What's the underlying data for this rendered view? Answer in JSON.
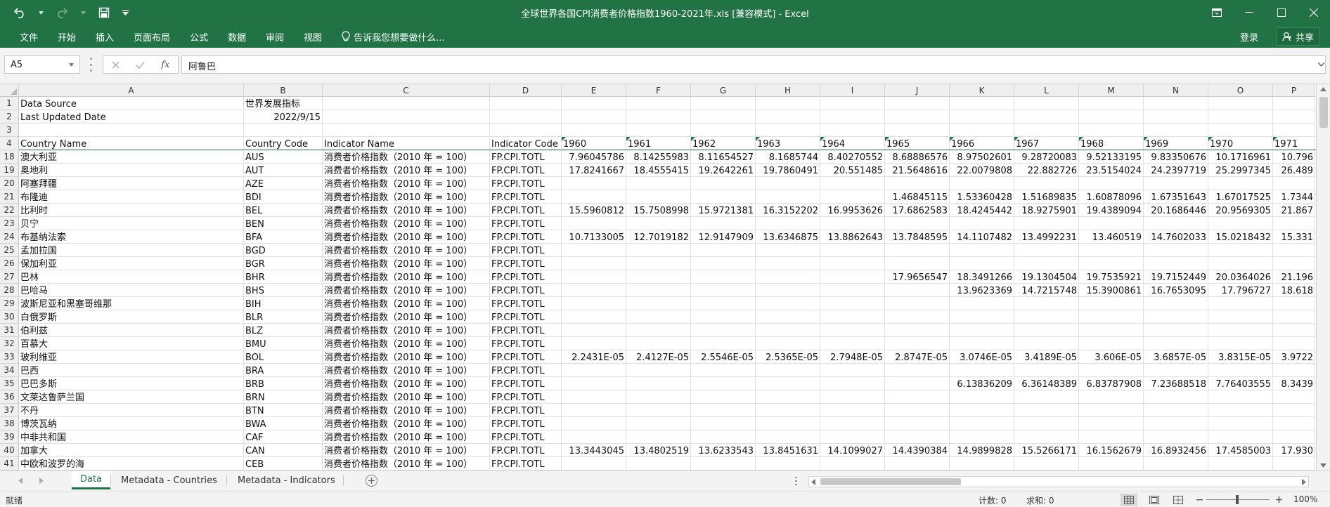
{
  "window": {
    "title": "全球世界各国CPI消费者价格指数1960-2021年.xls  [兼容模式] - Excel"
  },
  "ribbon": {
    "tabs": [
      "文件",
      "开始",
      "插入",
      "页面布局",
      "公式",
      "数据",
      "审阅",
      "视图"
    ],
    "tell_me": "告诉我您想要做什么...",
    "signin": "登录",
    "share": "共享"
  },
  "formula_bar": {
    "name_box": "A5",
    "fx": "fx",
    "content": "阿鲁巴"
  },
  "grid": {
    "column_headers": [
      "A",
      "B",
      "C",
      "D",
      "E",
      "F",
      "G",
      "H",
      "I",
      "J",
      "K",
      "L",
      "M",
      "N",
      "O",
      "P"
    ],
    "row_numbers": [
      "1",
      "2",
      "3",
      "4",
      "18",
      "19",
      "20",
      "21",
      "22",
      "23",
      "24",
      "25",
      "26",
      "27",
      "28",
      "29",
      "30",
      "31",
      "32",
      "33",
      "34",
      "35",
      "36",
      "37",
      "38",
      "39",
      "40",
      "41"
    ],
    "header_rows": [
      [
        "Data Source",
        "世界发展指标",
        "",
        "",
        "",
        "",
        "",
        "",
        "",
        "",
        "",
        "",
        "",
        "",
        "",
        ""
      ],
      [
        "Last Updated Date",
        "2022/9/15",
        "",
        "",
        "",
        "",
        "",
        "",
        "",
        "",
        "",
        "",
        "",
        "",
        "",
        ""
      ],
      [
        "",
        "",
        "",
        "",
        "",
        "",
        "",
        "",
        "",
        "",
        "",
        "",
        "",
        "",
        "",
        ""
      ],
      [
        "Country Name",
        "Country Code",
        "Indicator Name",
        "Indicator Code",
        "1960",
        "1961",
        "1962",
        "1963",
        "1964",
        "1965",
        "1966",
        "1967",
        "1968",
        "1969",
        "1970",
        "1971"
      ]
    ],
    "rows": [
      [
        "澳大利亚",
        "AUS",
        "消费者价格指数（2010 年 = 100）",
        "FP.CPI.TOTL",
        "7.96045786",
        "8.14255983",
        "8.11654527",
        "8.1685744",
        "8.40270552",
        "8.68886576",
        "8.97502601",
        "9.28720083",
        "9.52133195",
        "9.83350676",
        "10.1716961",
        "10.796"
      ],
      [
        "奥地利",
        "AUT",
        "消费者价格指数（2010 年 = 100）",
        "FP.CPI.TOTL",
        "17.8241667",
        "18.4555415",
        "19.2642261",
        "19.7860491",
        "20.551485",
        "21.5648616",
        "22.0079808",
        "22.882726",
        "23.5154024",
        "24.2397719",
        "25.2997345",
        "26.489"
      ],
      [
        "阿塞拜疆",
        "AZE",
        "消费者价格指数（2010 年 = 100）",
        "FP.CPI.TOTL",
        "",
        "",
        "",
        "",
        "",
        "",
        "",
        "",
        "",
        "",
        "",
        ""
      ],
      [
        "布隆迪",
        "BDI",
        "消费者价格指数（2010 年 = 100）",
        "FP.CPI.TOTL",
        "",
        "",
        "",
        "",
        "",
        "1.46845115",
        "1.53360428",
        "1.51689835",
        "1.60878096",
        "1.67351643",
        "1.67017525",
        "1.7344"
      ],
      [
        "比利时",
        "BEL",
        "消费者价格指数（2010 年 = 100）",
        "FP.CPI.TOTL",
        "15.5960812",
        "15.7508998",
        "15.9721381",
        "16.3152202",
        "16.9953626",
        "17.6862583",
        "18.4245442",
        "18.9275901",
        "19.4389094",
        "20.1686446",
        "20.9569305",
        "21.867"
      ],
      [
        "贝宁",
        "BEN",
        "消费者价格指数（2010 年 = 100）",
        "FP.CPI.TOTL",
        "",
        "",
        "",
        "",
        "",
        "",
        "",
        "",
        "",
        "",
        "",
        ""
      ],
      [
        "布基纳法索",
        "BFA",
        "消费者价格指数（2010 年 = 100）",
        "FP.CPI.TOTL",
        "10.7133005",
        "12.7019182",
        "12.9147909",
        "13.6346875",
        "13.8862643",
        "13.7848595",
        "14.1107482",
        "13.4992231",
        "13.460519",
        "14.7602033",
        "15.0218432",
        "15.331"
      ],
      [
        "孟加拉国",
        "BGD",
        "消费者价格指数（2010 年 = 100）",
        "FP.CPI.TOTL",
        "",
        "",
        "",
        "",
        "",
        "",
        "",
        "",
        "",
        "",
        "",
        ""
      ],
      [
        "保加利亚",
        "BGR",
        "消费者价格指数（2010 年 = 100）",
        "FP.CPI.TOTL",
        "",
        "",
        "",
        "",
        "",
        "",
        "",
        "",
        "",
        "",
        "",
        ""
      ],
      [
        "巴林",
        "BHR",
        "消费者价格指数（2010 年 = 100）",
        "FP.CPI.TOTL",
        "",
        "",
        "",
        "",
        "",
        "17.9656547",
        "18.3491266",
        "19.1304504",
        "19.7535921",
        "19.7152449",
        "20.0364026",
        "21.196"
      ],
      [
        "巴哈马",
        "BHS",
        "消费者价格指数（2010 年 = 100）",
        "FP.CPI.TOTL",
        "",
        "",
        "",
        "",
        "",
        "",
        "13.9623369",
        "14.7215748",
        "15.3900861",
        "16.7653095",
        "17.796727",
        "18.618"
      ],
      [
        "波斯尼亚和黑塞哥维那",
        "BIH",
        "消费者价格指数（2010 年 = 100）",
        "FP.CPI.TOTL",
        "",
        "",
        "",
        "",
        "",
        "",
        "",
        "",
        "",
        "",
        "",
        ""
      ],
      [
        "白俄罗斯",
        "BLR",
        "消费者价格指数（2010 年 = 100）",
        "FP.CPI.TOTL",
        "",
        "",
        "",
        "",
        "",
        "",
        "",
        "",
        "",
        "",
        "",
        ""
      ],
      [
        "伯利兹",
        "BLZ",
        "消费者价格指数（2010 年 = 100）",
        "FP.CPI.TOTL",
        "",
        "",
        "",
        "",
        "",
        "",
        "",
        "",
        "",
        "",
        "",
        ""
      ],
      [
        "百慕大",
        "BMU",
        "消费者价格指数（2010 年 = 100）",
        "FP.CPI.TOTL",
        "",
        "",
        "",
        "",
        "",
        "",
        "",
        "",
        "",
        "",
        "",
        ""
      ],
      [
        "玻利维亚",
        "BOL",
        "消费者价格指数（2010 年 = 100）",
        "FP.CPI.TOTL",
        "2.2431E-05",
        "2.4127E-05",
        "2.5546E-05",
        "2.5365E-05",
        "2.7948E-05",
        "2.8747E-05",
        "3.0746E-05",
        "3.4189E-05",
        "3.606E-05",
        "3.6857E-05",
        "3.8315E-05",
        "3.9722"
      ],
      [
        "巴西",
        "BRA",
        "消费者价格指数（2010 年 = 100）",
        "FP.CPI.TOTL",
        "",
        "",
        "",
        "",
        "",
        "",
        "",
        "",
        "",
        "",
        "",
        ""
      ],
      [
        "巴巴多斯",
        "BRB",
        "消费者价格指数（2010 年 = 100）",
        "FP.CPI.TOTL",
        "",
        "",
        "",
        "",
        "",
        "",
        "6.13836209",
        "6.36148389",
        "6.83787908",
        "7.23688518",
        "7.76403555",
        "8.3439"
      ],
      [
        "文莱达鲁萨兰国",
        "BRN",
        "消费者价格指数（2010 年 = 100）",
        "FP.CPI.TOTL",
        "",
        "",
        "",
        "",
        "",
        "",
        "",
        "",
        "",
        "",
        "",
        ""
      ],
      [
        "不丹",
        "BTN",
        "消费者价格指数（2010 年 = 100）",
        "FP.CPI.TOTL",
        "",
        "",
        "",
        "",
        "",
        "",
        "",
        "",
        "",
        "",
        "",
        ""
      ],
      [
        "博茨瓦纳",
        "BWA",
        "消费者价格指数（2010 年 = 100）",
        "FP.CPI.TOTL",
        "",
        "",
        "",
        "",
        "",
        "",
        "",
        "",
        "",
        "",
        "",
        ""
      ],
      [
        "中非共和国",
        "CAF",
        "消费者价格指数（2010 年 = 100）",
        "FP.CPI.TOTL",
        "",
        "",
        "",
        "",
        "",
        "",
        "",
        "",
        "",
        "",
        "",
        ""
      ],
      [
        "加拿大",
        "CAN",
        "消费者价格指数（2010 年 = 100）",
        "FP.CPI.TOTL",
        "13.3443045",
        "13.4802519",
        "13.6233543",
        "13.8451631",
        "14.1099027",
        "14.4390384",
        "14.9899828",
        "15.5266171",
        "16.1562679",
        "16.8932456",
        "17.4585003",
        "17.930"
      ],
      [
        "中欧和波罗的海",
        "CEB",
        "消费者价格指数（2010 年 = 100）",
        "FP.CPI.TOTL",
        "",
        "",
        "",
        "",
        "",
        "",
        "",
        "",
        "",
        "",
        "",
        ""
      ]
    ]
  },
  "sheets": {
    "tabs": [
      "Data",
      "Metadata - Countries",
      "Metadata - Indicators"
    ],
    "active": 0
  },
  "statusbar": {
    "ready": "就绪",
    "count": "计数: 0",
    "sum": "求和: 0",
    "zoom": "100%"
  }
}
